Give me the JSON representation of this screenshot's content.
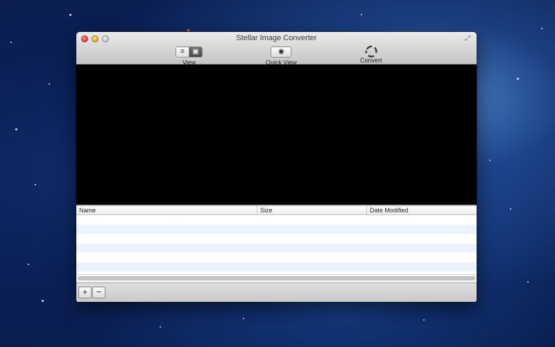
{
  "window": {
    "title": "Stellar Image Converter"
  },
  "toolbar": {
    "view_label": "View",
    "view_list_glyph": "≡",
    "view_thumb_glyph": "▣",
    "quick_view_label": "Quick View",
    "quick_view_glyph": "◉",
    "convert_label": "Convert"
  },
  "table": {
    "columns": [
      "Name",
      "Size",
      "Date Modified"
    ],
    "rows": []
  },
  "bottom": {
    "add_glyph": "+",
    "remove_glyph": "−"
  },
  "icons": {
    "view_list": "list-view-icon",
    "view_thumbnail": "thumbnail-view-icon",
    "quick_view": "eye-icon",
    "convert": "convert-cycle-icon",
    "fullscreen": "fullscreen-icon"
  },
  "colors": {
    "desktop": "#0b2157",
    "row_alt": "#edf3fe",
    "preview_bg": "#000000"
  }
}
